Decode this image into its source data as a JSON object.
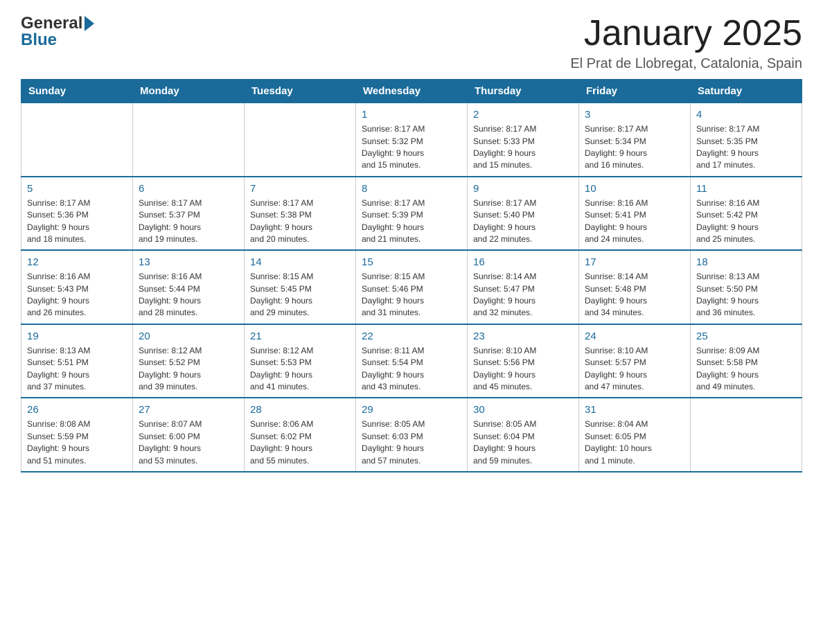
{
  "header": {
    "logo_text_general": "General",
    "logo_text_blue": "Blue",
    "month_title": "January 2025",
    "location": "El Prat de Llobregat, Catalonia, Spain"
  },
  "calendar": {
    "days_of_week": [
      "Sunday",
      "Monday",
      "Tuesday",
      "Wednesday",
      "Thursday",
      "Friday",
      "Saturday"
    ],
    "weeks": [
      [
        {
          "day": "",
          "info": ""
        },
        {
          "day": "",
          "info": ""
        },
        {
          "day": "",
          "info": ""
        },
        {
          "day": "1",
          "info": "Sunrise: 8:17 AM\nSunset: 5:32 PM\nDaylight: 9 hours\nand 15 minutes."
        },
        {
          "day": "2",
          "info": "Sunrise: 8:17 AM\nSunset: 5:33 PM\nDaylight: 9 hours\nand 15 minutes."
        },
        {
          "day": "3",
          "info": "Sunrise: 8:17 AM\nSunset: 5:34 PM\nDaylight: 9 hours\nand 16 minutes."
        },
        {
          "day": "4",
          "info": "Sunrise: 8:17 AM\nSunset: 5:35 PM\nDaylight: 9 hours\nand 17 minutes."
        }
      ],
      [
        {
          "day": "5",
          "info": "Sunrise: 8:17 AM\nSunset: 5:36 PM\nDaylight: 9 hours\nand 18 minutes."
        },
        {
          "day": "6",
          "info": "Sunrise: 8:17 AM\nSunset: 5:37 PM\nDaylight: 9 hours\nand 19 minutes."
        },
        {
          "day": "7",
          "info": "Sunrise: 8:17 AM\nSunset: 5:38 PM\nDaylight: 9 hours\nand 20 minutes."
        },
        {
          "day": "8",
          "info": "Sunrise: 8:17 AM\nSunset: 5:39 PM\nDaylight: 9 hours\nand 21 minutes."
        },
        {
          "day": "9",
          "info": "Sunrise: 8:17 AM\nSunset: 5:40 PM\nDaylight: 9 hours\nand 22 minutes."
        },
        {
          "day": "10",
          "info": "Sunrise: 8:16 AM\nSunset: 5:41 PM\nDaylight: 9 hours\nand 24 minutes."
        },
        {
          "day": "11",
          "info": "Sunrise: 8:16 AM\nSunset: 5:42 PM\nDaylight: 9 hours\nand 25 minutes."
        }
      ],
      [
        {
          "day": "12",
          "info": "Sunrise: 8:16 AM\nSunset: 5:43 PM\nDaylight: 9 hours\nand 26 minutes."
        },
        {
          "day": "13",
          "info": "Sunrise: 8:16 AM\nSunset: 5:44 PM\nDaylight: 9 hours\nand 28 minutes."
        },
        {
          "day": "14",
          "info": "Sunrise: 8:15 AM\nSunset: 5:45 PM\nDaylight: 9 hours\nand 29 minutes."
        },
        {
          "day": "15",
          "info": "Sunrise: 8:15 AM\nSunset: 5:46 PM\nDaylight: 9 hours\nand 31 minutes."
        },
        {
          "day": "16",
          "info": "Sunrise: 8:14 AM\nSunset: 5:47 PM\nDaylight: 9 hours\nand 32 minutes."
        },
        {
          "day": "17",
          "info": "Sunrise: 8:14 AM\nSunset: 5:48 PM\nDaylight: 9 hours\nand 34 minutes."
        },
        {
          "day": "18",
          "info": "Sunrise: 8:13 AM\nSunset: 5:50 PM\nDaylight: 9 hours\nand 36 minutes."
        }
      ],
      [
        {
          "day": "19",
          "info": "Sunrise: 8:13 AM\nSunset: 5:51 PM\nDaylight: 9 hours\nand 37 minutes."
        },
        {
          "day": "20",
          "info": "Sunrise: 8:12 AM\nSunset: 5:52 PM\nDaylight: 9 hours\nand 39 minutes."
        },
        {
          "day": "21",
          "info": "Sunrise: 8:12 AM\nSunset: 5:53 PM\nDaylight: 9 hours\nand 41 minutes."
        },
        {
          "day": "22",
          "info": "Sunrise: 8:11 AM\nSunset: 5:54 PM\nDaylight: 9 hours\nand 43 minutes."
        },
        {
          "day": "23",
          "info": "Sunrise: 8:10 AM\nSunset: 5:56 PM\nDaylight: 9 hours\nand 45 minutes."
        },
        {
          "day": "24",
          "info": "Sunrise: 8:10 AM\nSunset: 5:57 PM\nDaylight: 9 hours\nand 47 minutes."
        },
        {
          "day": "25",
          "info": "Sunrise: 8:09 AM\nSunset: 5:58 PM\nDaylight: 9 hours\nand 49 minutes."
        }
      ],
      [
        {
          "day": "26",
          "info": "Sunrise: 8:08 AM\nSunset: 5:59 PM\nDaylight: 9 hours\nand 51 minutes."
        },
        {
          "day": "27",
          "info": "Sunrise: 8:07 AM\nSunset: 6:00 PM\nDaylight: 9 hours\nand 53 minutes."
        },
        {
          "day": "28",
          "info": "Sunrise: 8:06 AM\nSunset: 6:02 PM\nDaylight: 9 hours\nand 55 minutes."
        },
        {
          "day": "29",
          "info": "Sunrise: 8:05 AM\nSunset: 6:03 PM\nDaylight: 9 hours\nand 57 minutes."
        },
        {
          "day": "30",
          "info": "Sunrise: 8:05 AM\nSunset: 6:04 PM\nDaylight: 9 hours\nand 59 minutes."
        },
        {
          "day": "31",
          "info": "Sunrise: 8:04 AM\nSunset: 6:05 PM\nDaylight: 10 hours\nand 1 minute."
        },
        {
          "day": "",
          "info": ""
        }
      ]
    ]
  }
}
